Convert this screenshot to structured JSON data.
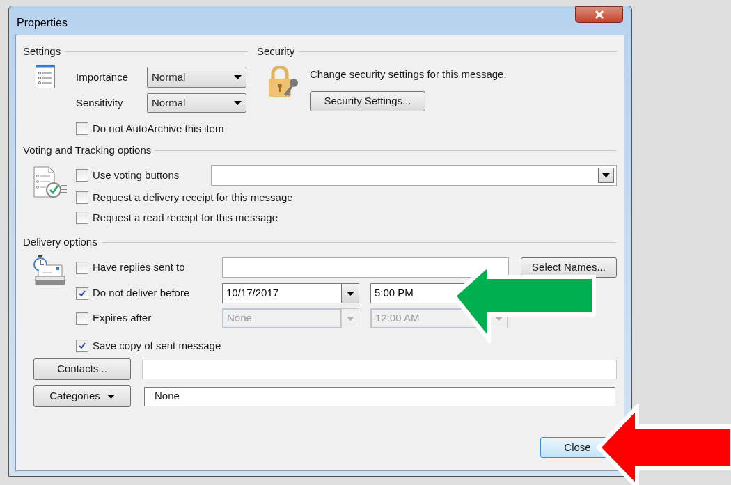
{
  "window": {
    "title": "Properties"
  },
  "settings": {
    "title": "Settings",
    "fields": [
      {
        "label": "Importance",
        "value": "Normal"
      },
      {
        "label": "Sensitivity",
        "value": "Normal"
      }
    ],
    "no_autoarchive": {
      "label": "Do not AutoArchive this item",
      "checked": false
    }
  },
  "security": {
    "title": "Security",
    "text": "Change security settings for this message.",
    "button": "Security Settings..."
  },
  "voting": {
    "title": "Voting and Tracking options",
    "options": [
      {
        "label": "Use voting buttons",
        "checked": false
      },
      {
        "label": "Request a delivery receipt for this message",
        "checked": false
      },
      {
        "label": "Request a read receipt for this message",
        "checked": false
      }
    ]
  },
  "delivery": {
    "title": "Delivery options",
    "options": [
      {
        "kind": "address",
        "label": "Have replies sent to",
        "checked": false,
        "button": "Select Names..."
      },
      {
        "kind": "datetime",
        "label": "Do not deliver before",
        "checked": true,
        "date": "10/17/2017",
        "time": "5:00 PM",
        "disabled": false
      },
      {
        "kind": "datetime",
        "label": "Expires after",
        "checked": false,
        "date": "None",
        "time": "12:00 AM",
        "disabled": true
      },
      {
        "kind": "plain",
        "label": "Save copy of sent message",
        "checked": true
      }
    ]
  },
  "contacts": {
    "button": "Contacts..."
  },
  "categories": {
    "button": "Categories",
    "value": "None"
  },
  "close_button": "Close"
}
